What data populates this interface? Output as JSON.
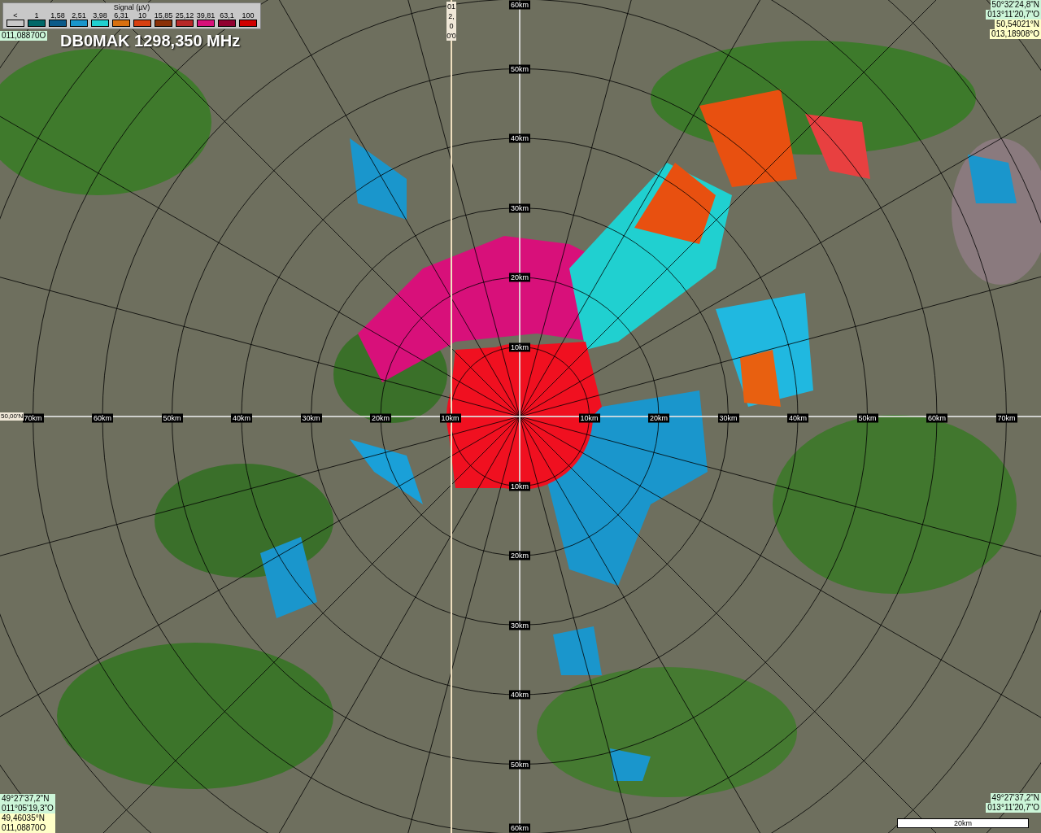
{
  "title": "DB0MAK 1298,350 MHz",
  "legend": {
    "title": "Signal (µV)",
    "items": [
      {
        "label": "<",
        "color": "#c8c8c8"
      },
      {
        "label": "1",
        "color": "#006868"
      },
      {
        "label": "1,58",
        "color": "#0a5a8a"
      },
      {
        "label": "2,51",
        "color": "#1a96cc"
      },
      {
        "label": "3,98",
        "color": "#20d0d0"
      },
      {
        "label": "6,31",
        "color": "#d87010"
      },
      {
        "label": "10",
        "color": "#d84010"
      },
      {
        "label": "15,85",
        "color": "#8a3008"
      },
      {
        "label": "25,12",
        "color": "#b82828"
      },
      {
        "label": "39,81",
        "color": "#d8107a"
      },
      {
        "label": "63,1",
        "color": "#900030"
      },
      {
        "label": "100",
        "color": "#d00000"
      }
    ]
  },
  "axis_labels": {
    "west": [
      "70km",
      "60km",
      "50km",
      "40km",
      "30km",
      "20km",
      "10km"
    ],
    "east": [
      "10km",
      "20km",
      "30km",
      "40km",
      "50km",
      "60km",
      "70km"
    ],
    "north": [
      "60km",
      "50km",
      "40km",
      "30km",
      "20km",
      "10km"
    ],
    "south": [
      "10km",
      "20km",
      "30km",
      "40km",
      "50km",
      "60km"
    ]
  },
  "meridian_label": "012,00'0",
  "parallel_label": "50,00'N",
  "corners": {
    "top_left": [
      "011,08870O"
    ],
    "top_right": [
      "50°32'24,8\"N",
      "013°11'20,7\"O",
      "50,54021°N",
      "013,18908°O"
    ],
    "bottom_left": [
      "49°27'37,2\"N",
      "011°05'19,3\"O",
      "49,46035°N",
      "011,08870O"
    ],
    "bottom_right": [
      "49°27'37,2\"N",
      "013°11'20,7\"O"
    ]
  },
  "scale_bar": "20km"
}
